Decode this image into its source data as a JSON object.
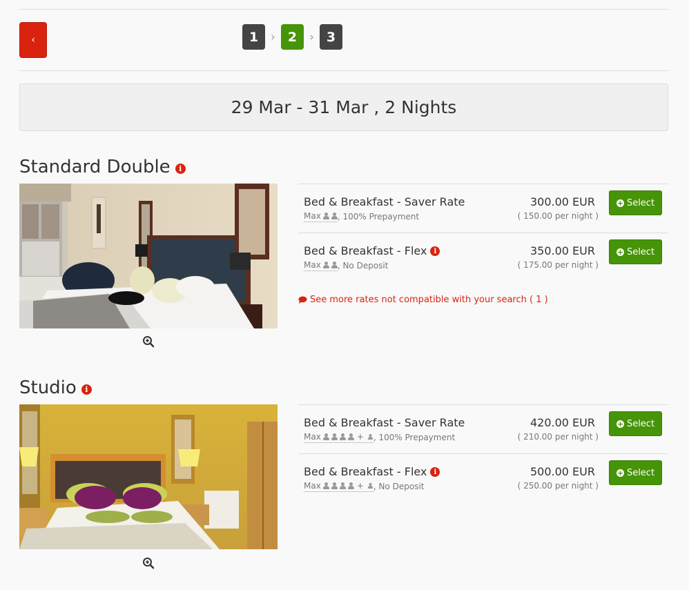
{
  "nav": {
    "back_label": "‹",
    "steps": [
      "1",
      "2",
      "3"
    ],
    "step_separator": "›",
    "active_step": "2"
  },
  "stay": {
    "summary": "29 Mar - 31 Mar , 2 Nights"
  },
  "rooms": [
    {
      "title": "Standard Double",
      "rates": [
        {
          "name": "Bed & Breakfast - Saver Rate",
          "max_label": "Max",
          "adults": 2,
          "children": 0,
          "policy": ", 100% Prepayment",
          "price": "300.00 EUR",
          "per_night": "( 150.00 per night )",
          "select_label": "Select",
          "has_info": false
        },
        {
          "name": "Bed & Breakfast - Flex",
          "max_label": "Max",
          "adults": 2,
          "children": 0,
          "policy": ", No Deposit",
          "price": "350.00 EUR",
          "per_night": "( 175.00 per night )",
          "select_label": "Select",
          "has_info": true
        }
      ],
      "more_rates": "See more rates not compatible with your search ( 1 )"
    },
    {
      "title": "Studio",
      "rates": [
        {
          "name": "Bed & Breakfast - Saver Rate",
          "max_label": "Max",
          "adults": 4,
          "children": 1,
          "policy": ", 100% Prepayment",
          "price": "420.00 EUR",
          "per_night": "( 210.00 per night )",
          "select_label": "Select",
          "has_info": false
        },
        {
          "name": "Bed & Breakfast - Flex",
          "max_label": "Max",
          "adults": 4,
          "children": 1,
          "policy": ", No Deposit",
          "price": "500.00 EUR",
          "per_night": "( 250.00 per night )",
          "select_label": "Select",
          "has_info": true
        }
      ]
    }
  ],
  "icons": {
    "back": "chevron-left-icon",
    "info": "info-circle-icon",
    "zoom": "zoom-in-icon",
    "select": "plus-circle-icon",
    "more_rates": "comment-icon",
    "person": "user-icon"
  },
  "colors": {
    "red": "#d9230f",
    "green": "#469408",
    "step_dark": "#444444"
  }
}
